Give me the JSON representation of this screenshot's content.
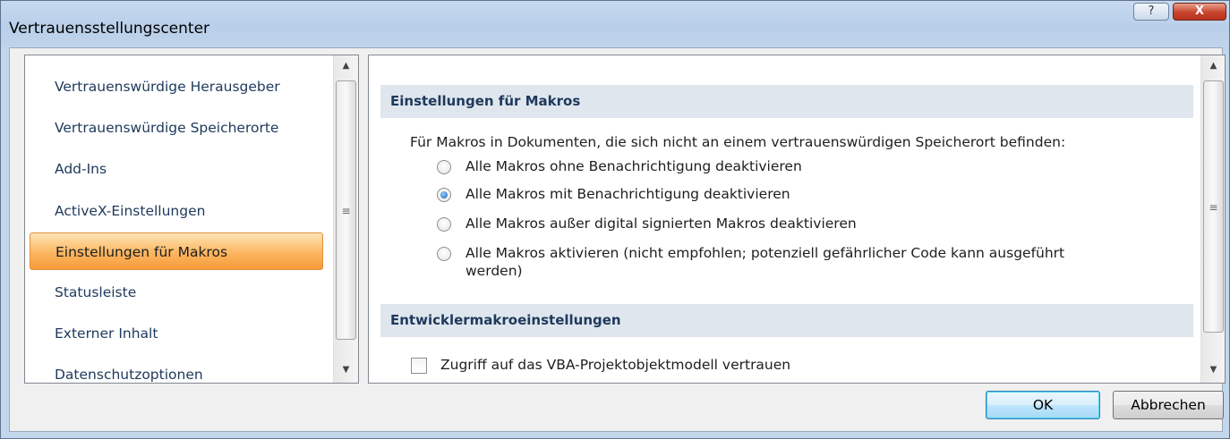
{
  "window": {
    "title": "Vertrauensstellungscenter",
    "help_glyph": "?",
    "close_glyph": "X"
  },
  "nav": {
    "items": [
      {
        "label": "Vertrauenswürdige Herausgeber"
      },
      {
        "label": "Vertrauenswürdige Speicherorte"
      },
      {
        "label": "Add-Ins"
      },
      {
        "label": "ActiveX-Einstellungen"
      },
      {
        "label": "Einstellungen für Makros",
        "selected": true
      },
      {
        "label": "Statusleiste"
      },
      {
        "label": "Externer Inhalt"
      },
      {
        "label": "Datenschutzoptionen"
      }
    ]
  },
  "macros": {
    "header": "Einstellungen für Makros",
    "intro": "Für Makros in Dokumenten, die sich nicht an einem vertrauenswürdigen Speicherort befinden:",
    "options": [
      {
        "label": "Alle Makros ohne Benachrichtigung deaktivieren",
        "checked": false
      },
      {
        "label": "Alle Makros mit Benachrichtigung deaktivieren",
        "checked": true
      },
      {
        "label": "Alle Makros außer digital signierten Makros deaktivieren",
        "checked": false
      },
      {
        "label_line1": "Alle Makros aktivieren (nicht empfohlen; potenziell gefährlicher Code kann ausgeführt",
        "label_line2": "werden)",
        "checked": false
      }
    ]
  },
  "developer": {
    "header": "Entwicklermakroeinstellungen",
    "vba_trust_label": "Zugriff auf das VBA-Projektobjektmodell vertrauen",
    "vba_trust_checked": false
  },
  "buttons": {
    "ok": "OK",
    "cancel": "Abbrechen"
  },
  "icons": {
    "scroll_up": "scroll-up-arrow-icon",
    "scroll_down": "scroll-down-arrow-icon",
    "grip": "scroll-grip-icon"
  }
}
